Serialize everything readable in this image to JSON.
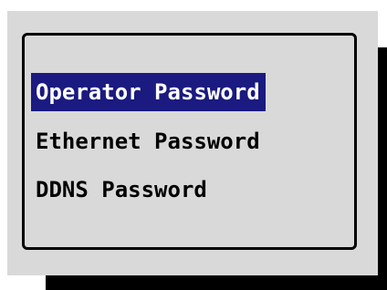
{
  "menu": {
    "items": [
      {
        "label": "Operator Password",
        "selected": true
      },
      {
        "label": "Ethernet Password",
        "selected": false
      },
      {
        "label": "DDNS Password",
        "selected": false
      }
    ]
  },
  "colors": {
    "panel_background": "#d9d9d9",
    "selection_background": "#1a1a80",
    "selection_text": "#ffffff",
    "text": "#000000",
    "shadow": "#000000"
  }
}
